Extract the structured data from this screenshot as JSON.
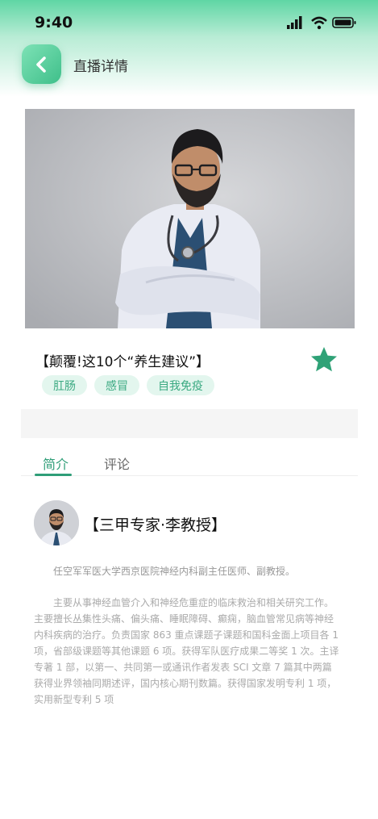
{
  "status_bar": {
    "time": "9:40",
    "icons": [
      "signal-icon",
      "wifi-icon",
      "battery-icon"
    ]
  },
  "nav": {
    "back_icon": "chevron-left-icon",
    "title": "直播详情"
  },
  "live": {
    "title": "【颠覆!这10个“养生建议”】",
    "favorite_icon": "star-icon",
    "tags": [
      "肛肠",
      "感冒",
      "自我免疫"
    ]
  },
  "tabs": [
    {
      "label": "简介",
      "active": true
    },
    {
      "label": "评论",
      "active": false
    }
  ],
  "doctor": {
    "name": "【三甲专家·李教授】",
    "intro": "任空军军医大学西京医院神经内科副主任医师、副教授。",
    "detail": "主要从事神经血管介入和神经危重症的临床救治和相关研究工作。主要擅长丛集性头痛、偏头痛、睡眠障碍、癫痫，脑血管常见病等神经内科疾病的治疗。负责国家 863 重点课题子课题和国科金面上项目各 1 项，省部级课题等其他课题 6 项。获得军队医疗成果二等奖 1 次。主译专著 1 部，以第一、共同第一或通讯作者发表 SCI 文章 7 篇其中两篇获得业界领袖同期述评，国内核心期刊数篇。获得国家发明专利 1 项，实用新型专利 5 项"
  },
  "colors": {
    "accent": "#2f9e78",
    "tag_bg": "#e3f6ee",
    "star": "#2fa277"
  }
}
